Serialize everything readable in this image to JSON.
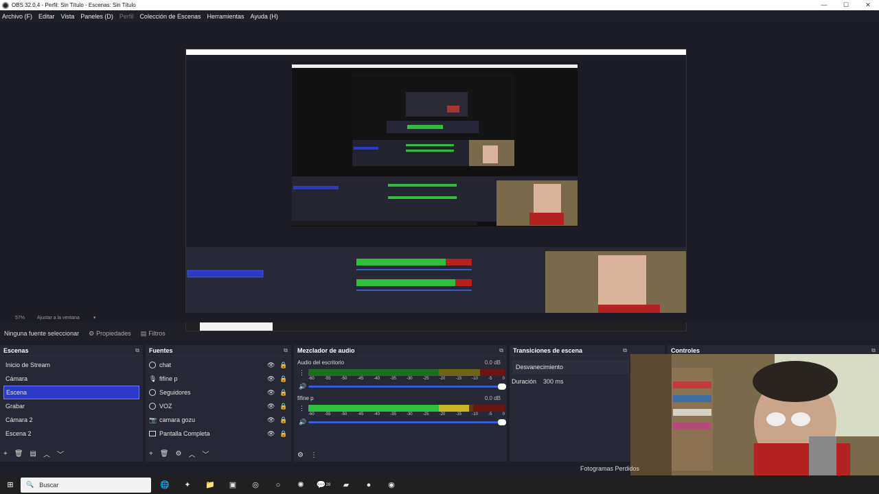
{
  "window": {
    "title": "OBS 32.0.4 - Perfil: Sin Título - Escenas: Sin Título",
    "minimize": "—",
    "maximize": "☐",
    "close": "✕"
  },
  "menu": [
    "Archivo (F)",
    "Editar",
    "Vista",
    "Paneles (D)",
    "Perfil",
    "Colección de Escenas",
    "Herramientas",
    "Ayuda (H)"
  ],
  "zoom": {
    "percent": "57%",
    "fit": "Ajustar a la ventana"
  },
  "properties_bar": {
    "no_source": "Ninguna fuente seleccionar",
    "properties": "Propiedades",
    "filters": "Filtros"
  },
  "scenes": {
    "title": "Escenas",
    "items": [
      "Inicio de Stream",
      "Cámara",
      "Escena",
      "Grabar",
      "Cámara 2",
      "Escena 2"
    ],
    "selected": 2
  },
  "sources": {
    "title": "Fuentes",
    "items": [
      {
        "name": "chat",
        "icon": "browser-icon"
      },
      {
        "name": "fifine p",
        "icon": "microphone-icon"
      },
      {
        "name": "Seguidores",
        "icon": "browser-icon"
      },
      {
        "name": "VOZ",
        "icon": "browser-icon"
      },
      {
        "name": "camara gozu",
        "icon": "camera-icon"
      },
      {
        "name": "Pantalla Completa",
        "icon": "monitor-icon"
      }
    ]
  },
  "mixer": {
    "title": "Mezclador de audio",
    "ticks": [
      "-60",
      "-55",
      "-50",
      "-45",
      "-40",
      "-35",
      "-30",
      "-25",
      "-20",
      "-15",
      "-10",
      "-5",
      "0"
    ],
    "channels": [
      {
        "name": "Audio del escritorio",
        "db": "0.0 dB",
        "level": 0.0
      },
      {
        "name": "fifine p",
        "db": "0.0 dB",
        "level": 0.82
      }
    ]
  },
  "transitions": {
    "title": "Transiciones de escena",
    "type": "Desvanecimiento",
    "duration_label": "Duración",
    "duration": "300 ms"
  },
  "controls": {
    "title": "Controles"
  },
  "status": {
    "frames": "Fotogramas Perdidos"
  },
  "taskbar": {
    "search": "Buscar",
    "whatsapp_badge": "28"
  },
  "colors": {
    "selection": "#2b39c9",
    "meter_green": "#2fbf3a",
    "meter_yellow": "#c8b623",
    "meter_red": "#b8201d"
  }
}
